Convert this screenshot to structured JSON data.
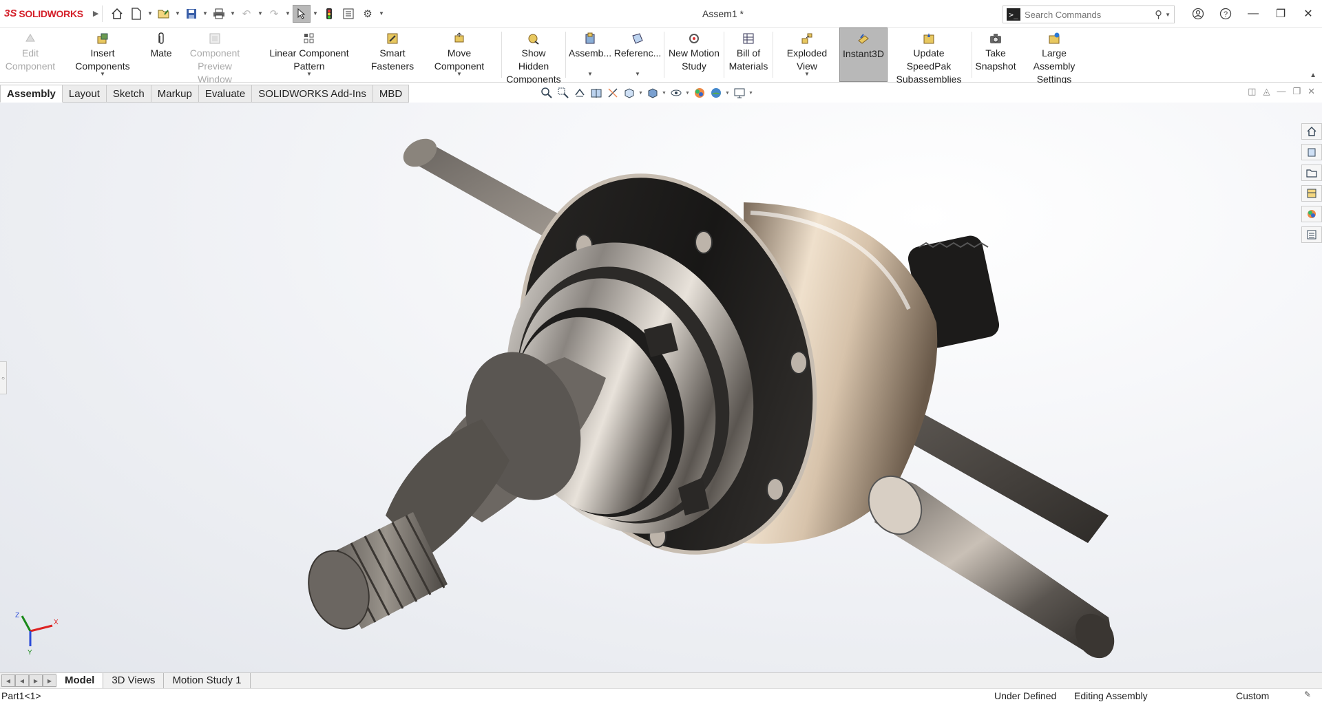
{
  "app": {
    "logo_prefix": "3S",
    "brand": "SOLIDWORKS",
    "document_title": "Assem1 *"
  },
  "search": {
    "placeholder": "Search Commands"
  },
  "ribbon": {
    "edit_component": "Edit Component",
    "insert_components": "Insert Components",
    "mate": "Mate",
    "component_preview": "Component Preview Window",
    "linear_pattern": "Linear Component Pattern",
    "smart_fasteners": "Smart Fasteners",
    "move_component": "Move Component",
    "show_hidden": "Show Hidden Components",
    "assembly_features": "Assemb...",
    "reference_geometry": "Referenc...",
    "new_motion_study": "New Motion Study",
    "bill_of_materials": "Bill of Materials",
    "exploded_view": "Exploded View",
    "instant3d": "Instant3D",
    "update_speedpak": "Update SpeedPak Subassemblies",
    "take_snapshot": "Take Snapshot",
    "large_assembly": "Large Assembly Settings"
  },
  "tabs": [
    "Assembly",
    "Layout",
    "Sketch",
    "Markup",
    "Evaluate",
    "SOLIDWORKS Add-Ins",
    "MBD"
  ],
  "triad": {
    "z": "Z",
    "x": "X",
    "y": "Y"
  },
  "bottom_tabs": [
    "Model",
    "3D Views",
    "Motion Study 1"
  ],
  "status": {
    "selection": "Part1<1>",
    "definition": "Under Defined",
    "mode": "Editing Assembly",
    "units": "Custom"
  },
  "colors": {
    "brand": "#d4202a",
    "active_tool": "#b8b8b8"
  }
}
